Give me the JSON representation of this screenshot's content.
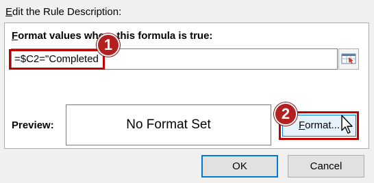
{
  "section_title": {
    "accel": "E",
    "rest": "dit the Rule Description:"
  },
  "formula_label": {
    "accel": "F",
    "rest": "ormat values where this formula is true:"
  },
  "formula_value": "=$C2=\"Completed",
  "preview": {
    "label": "Preview:",
    "text": "No Format Set"
  },
  "format_button": {
    "accel": "F",
    "rest": "ormat..."
  },
  "ok_label": "OK",
  "cancel_label": "Cancel",
  "callouts": [
    "1",
    "2"
  ],
  "colors": {
    "highlight": "#c00000",
    "badge": "#b32020",
    "focus": "#0078d7"
  },
  "icons": {
    "range_selector": "collapse-dialog-icon",
    "cursor": "mouse-pointer-icon"
  }
}
